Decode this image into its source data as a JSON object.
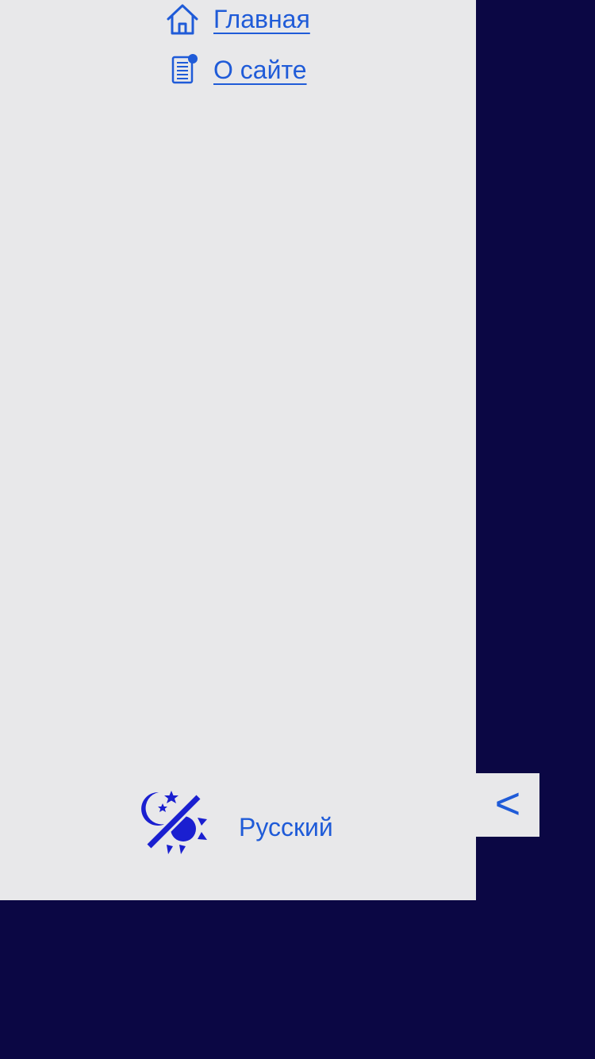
{
  "nav": {
    "items": [
      {
        "label": "Главная",
        "icon": "home-icon"
      },
      {
        "label": "О сайте",
        "icon": "document-icon"
      }
    ]
  },
  "footer": {
    "theme_icon": "day-night-toggle-icon",
    "language": "Русский"
  },
  "collapse": {
    "glyph": "<"
  },
  "colors": {
    "background": "#0b0744",
    "drawer": "#e8e8ea",
    "accent": "#1f5bd8",
    "theme_icon": "#1a1fd0"
  }
}
